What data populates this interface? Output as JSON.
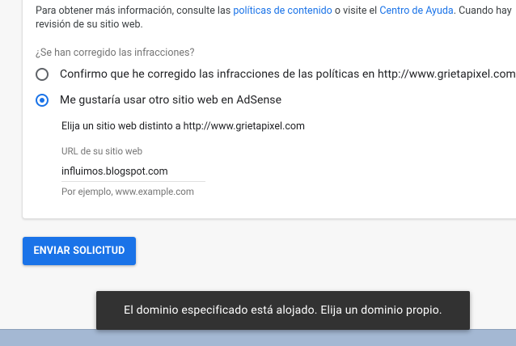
{
  "info": {
    "prefix": "Para obtener más información, consulte las ",
    "policies_link": "políticas de contenido",
    "middle": " o visite el ",
    "help_link": "Centro de Ayuda",
    "suffix": ". Cuando hay",
    "line2": "revisión de su sitio web."
  },
  "form": {
    "question": "¿Se han corregido las infracciones?",
    "options": [
      {
        "label": "Confirmo que he corregido las infracciones de las políticas en http://www.grietapixel.com",
        "checked": false
      },
      {
        "label": "Me gustaría usar otro sitio web en AdSense",
        "checked": true
      }
    ],
    "choose_text": "Elija un sitio web distinto a http://www.grietapixel.com",
    "url_label": "URL de su sitio web",
    "url_value": "influimos.blogspot.com",
    "url_hint": "Por ejemplo, www.example.com"
  },
  "submit_label": "ENVIAR SOLICITUD",
  "snackbar": {
    "message": "El dominio especificado está alojado. Elija un dominio propio."
  },
  "colors": {
    "accent": "#1a73e8",
    "snackbar_bg": "#323232",
    "taskbar": "#a4b8d3"
  }
}
